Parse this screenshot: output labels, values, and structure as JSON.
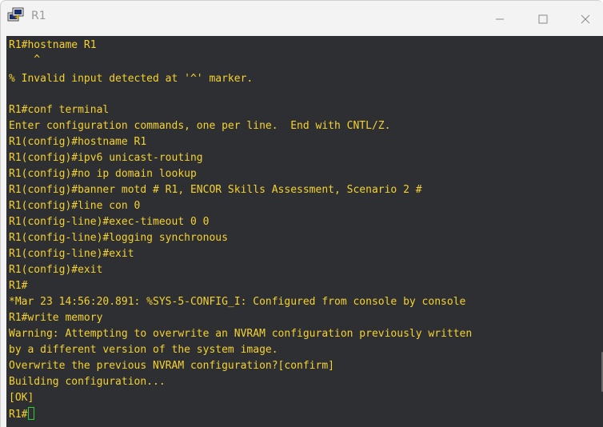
{
  "window": {
    "title": "R1",
    "app_icon": "putty-icon"
  },
  "colors": {
    "terminal_bg": "#2d2f33",
    "terminal_text": "#f6d22e",
    "cursor": "#2ecf2e",
    "titlebar_bg": "#f3f3f3"
  },
  "terminal": {
    "lines": [
      "R1#hostname R1",
      "    ^",
      "% Invalid input detected at '^' marker.",
      "",
      "R1#conf terminal",
      "Enter configuration commands, one per line.  End with CNTL/Z.",
      "R1(config)#hostname R1",
      "R1(config)#ipv6 unicast-routing",
      "R1(config)#no ip domain lookup",
      "R1(config)#banner motd # R1, ENCOR Skills Assessment, Scenario 2 #",
      "R1(config)#line con 0",
      "R1(config-line)#exec-timeout 0 0",
      "R1(config-line)#logging synchronous",
      "R1(config-line)#exit",
      "R1(config)#exit",
      "R1#",
      "*Mar 23 14:56:20.891: %SYS-5-CONFIG_I: Configured from console by console",
      "R1#write memory",
      "Warning: Attempting to overwrite an NVRAM configuration previously written",
      "by a different version of the system image.",
      "Overwrite the previous NVRAM configuration?[confirm]",
      "Building configuration...",
      "[OK]"
    ],
    "prompt": "R1#"
  }
}
